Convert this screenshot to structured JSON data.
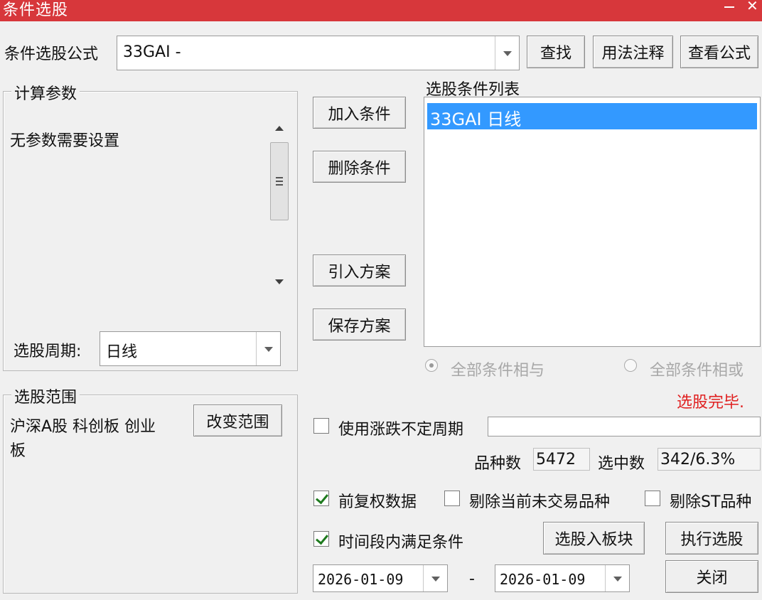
{
  "window": {
    "title": "条件选股"
  },
  "formula": {
    "label": "条件选股公式",
    "value": "33GAI  -",
    "find_button": "查找",
    "usage_button": "用法注释",
    "view_formula_button": "查看公式"
  },
  "params": {
    "group_title": "计算参数",
    "message": "无参数需要设置",
    "period_label": "选股周期:",
    "period_value": "日线"
  },
  "actions": {
    "add_condition": "加入条件",
    "delete_condition": "删除条件",
    "import_plan": "引入方案",
    "save_plan": "保存方案"
  },
  "conditions": {
    "title": "选股条件列表",
    "items": [
      "33GAI  日线"
    ],
    "radio_and": "全部条件相与",
    "radio_or": "全部条件相或"
  },
  "status": {
    "text": "选股完毕.",
    "color": "#e02020"
  },
  "scope": {
    "group_title": "选股范围",
    "line1": "沪深A股 科创板 创业",
    "line2": "板",
    "change_button": "改变范围"
  },
  "options": {
    "variable_period_label": "使用涨跌不定周期",
    "variable_period_value": "",
    "variety_count_label": "品种数",
    "variety_count_value": "5472",
    "selected_count_label": "选中数",
    "selected_count_value": "342/6.3%",
    "fq_label": "前复权数据",
    "fq_checked": true,
    "exclude_untraded_label": "剔除当前未交易品种",
    "exclude_untraded_checked": false,
    "exclude_st_label": "剔除ST品种",
    "exclude_st_checked": false,
    "time_range_label": "时间段内满足条件",
    "time_range_checked": true,
    "start_date": "2026-01-09",
    "date_separator": "-",
    "end_date": "2026-01-09"
  },
  "footer": {
    "to_block_button": "选股入板块",
    "execute_button": "执行选股",
    "close_button": "关闭"
  }
}
